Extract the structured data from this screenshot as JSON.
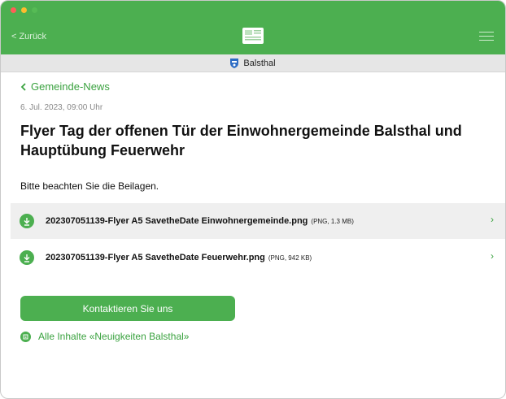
{
  "nav": {
    "back_label": "Zurück",
    "logo_icon": "newspaper-icon",
    "menu_icon": "hamburger-menu-icon"
  },
  "subbar": {
    "location": "Balsthal",
    "crest_icon": "coat-of-arms-icon"
  },
  "article": {
    "back_link": "Gemeinde-News",
    "date": "6. Jul. 2023, 09:00 Uhr",
    "title": "Flyer Tag der offenen Tür der Einwohnergemeinde Balsthal und Hauptübung Feuerwehr",
    "body": "Bitte beachten Sie die Beilagen."
  },
  "attachments": [
    {
      "name": "202307051139-Flyer A5 SavetheDate Einwohnergemeinde.png",
      "meta": "(PNG, 1.3 MB)"
    },
    {
      "name": "202307051139-Flyer A5 SavetheDate Feuerwehr.png",
      "meta": "(PNG, 942 KB)"
    }
  ],
  "actions": {
    "contact_label": "Kontaktieren Sie uns",
    "all_content_label": "Alle Inhalte «Neuigkeiten Balsthal»"
  },
  "colors": {
    "accent": "#4caf50",
    "link": "#3aa23f"
  }
}
